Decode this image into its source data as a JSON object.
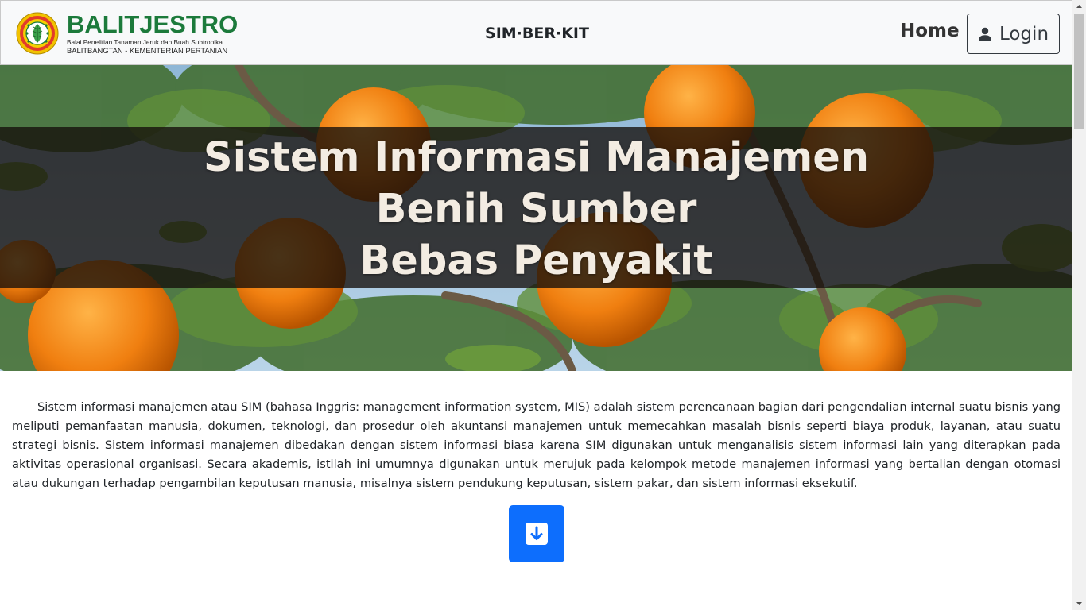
{
  "navbar": {
    "brand_name": "BALITJESTRO",
    "brand_subtitle": "Balai Penelitian Tanaman Jeruk dan Buah Subtropika",
    "brand_subtitle2": "BALITBANGTAN - KEMENTERIAN PERTANIAN",
    "app_title": "SIM·BER·KIT",
    "home_label": "Home",
    "login_label": "Login"
  },
  "hero": {
    "title_line1": "Sistem Informasi Manajemen",
    "title_line2": "Benih Sumber",
    "title_line3": "Bebas Penyakit"
  },
  "content": {
    "description": "Sistem informasi manajemen atau SIM (bahasa Inggris: management information system, MIS) adalah sistem perencanaan bagian dari pengendalian internal suatu bisnis yang meliputi pemanfaatan manusia, dokumen, teknologi, dan prosedur oleh akuntansi manajemen untuk memecahkan masalah bisnis seperti biaya produk, layanan, atau suatu strategi bisnis. Sistem informasi manajemen dibedakan dengan sistem informasi biasa karena SIM digunakan untuk menganalisis sistem informasi lain yang diterapkan pada aktivitas operasional organisasi. Secara akademis, istilah ini umumnya digunakan untuk merujuk pada kelompok metode manajemen informasi yang bertalian dengan otomasi atau dukungan terhadap pengambilan keputusan manusia, misalnya sistem pendukung keputusan, sistem pakar, dan sistem informasi eksekutif."
  },
  "icons": {
    "logo": "balitjestro-logo",
    "user": "user-icon",
    "download": "arrow-down-square-icon"
  },
  "colors": {
    "brand_green": "#1c7a3b",
    "primary": "#0d6efd",
    "navbar_bg": "#f8f9fa"
  }
}
